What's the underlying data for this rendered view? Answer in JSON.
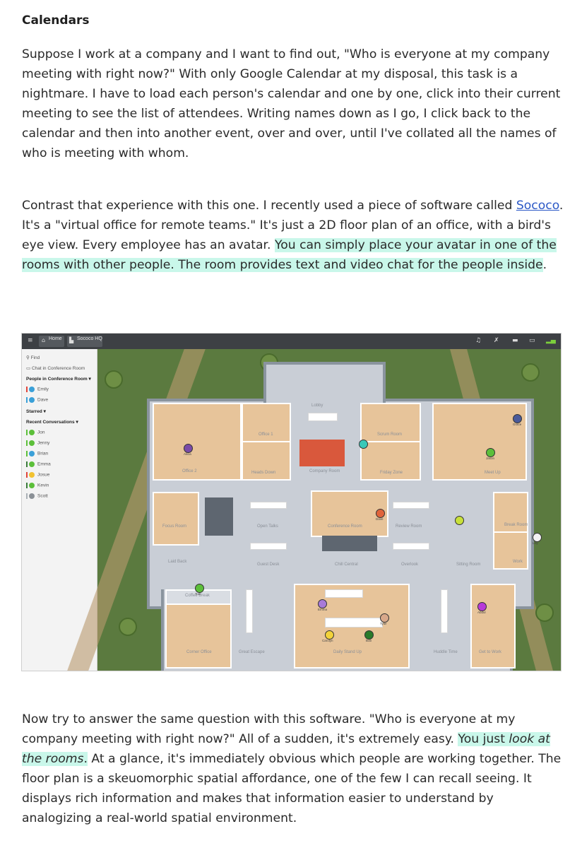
{
  "heading": "Calendars",
  "para1": "Suppose I work at a company and I want to find out, \"Who is everyone at my company meeting with right now?\" With only Google Calendar at my disposal, this task is a nightmare. I have to load each person's calendar and one by one, click into their current meeting to see the list of attendees. Writing names down as I go, I click back to the calendar and then into another event, over and over, until I've collated all the names of who is meeting with whom.",
  "para2": {
    "before_link": "Contrast that experience with this one. I recently used a piece of software called ",
    "link": "Sococo",
    "after_link": ". It's a \"virtual office for remote teams.\" It's just a 2D floor plan of an office, with a bird's eye view. Every employee has an avatar. ",
    "highlight": "You can simply place your avatar in one of the rooms with other people. The room provides text and video chat for the people inside",
    "end": "."
  },
  "para3": {
    "before": "Now try to answer the same question with this software. \"Who is everyone at my company meeting with right now?\" All of a sudden, it's extremely easy. ",
    "hl_plain": "You just ",
    "hl_em": "look at the rooms",
    "hl_end": ".",
    "after": " At a glance, it's immediately obvious which people are working together. The floor plan is a skeuomorphic spatial affordance, one of the few I can recall seeing. It displays rich information and makes that information easier to understand by analogizing a real-world spatial environment."
  },
  "screenshot": {
    "topbar": {
      "home": "Home",
      "office": "Sococo HQ"
    },
    "sidebar": {
      "find": "Find",
      "chat": "Chat in Conference Room",
      "people_header": "People in Conference Room",
      "people": [
        "Emily",
        "Dave"
      ],
      "starred": "Starred",
      "recent": "Recent Conversations",
      "recent_people": [
        "Jon",
        "Jenny",
        "Brian",
        "Emma",
        "Josue",
        "Kevin",
        "Scott"
      ]
    },
    "rooms": {
      "lobby": "Lobby",
      "office1": "Office 1",
      "office2": "Office 2",
      "scrum": "Scrum Room",
      "heads_down": "Heads Down",
      "company": "Company Room",
      "friday": "Friday Zone",
      "meet_up": "Meet Up",
      "focus": "Focus Room",
      "open_talks": "Open Talks",
      "conference": "Conference Room",
      "review": "Review Room",
      "break": "Break Room",
      "laid_back": "Laid Back",
      "guest_desk": "Guest Desk",
      "chill": "Chill Central",
      "overlook": "Overlook",
      "sitting": "Sitting Room",
      "work": "Work",
      "coffee": "Coffee Break",
      "corner": "Corner Office",
      "great_escape": "Great Escape",
      "daily": "Daily Stand Up",
      "huddle": "Huddle Time",
      "get_to_work": "Get to Work"
    },
    "avatars": [
      "Grace",
      "Alicia",
      "Jason",
      "Dave",
      "Lilly",
      "Tom",
      "Emma",
      "Tyler",
      "Carolyn",
      "Bob",
      "Abdul"
    ]
  }
}
